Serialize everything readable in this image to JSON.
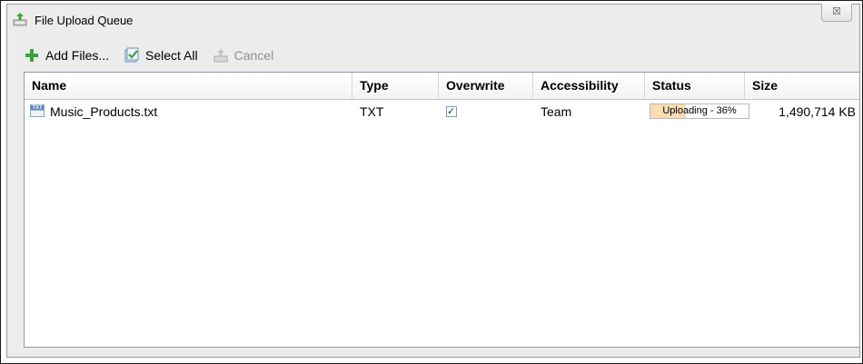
{
  "window": {
    "title": "File Upload Queue",
    "close_glyph": "☒"
  },
  "toolbar": {
    "add_files": "Add Files...",
    "select_all": "Select All",
    "cancel": "Cancel"
  },
  "table": {
    "columns": [
      "Name",
      "Type",
      "Overwrite",
      "Accessibility",
      "Status",
      "Size"
    ],
    "rows": [
      {
        "name": "Music_Products.txt",
        "file_icon_label": "TXT",
        "type": "TXT",
        "overwrite": true,
        "overwrite_glyph": "✓",
        "accessibility": "Team",
        "status": "Uploading - 36%",
        "progress_percent": 36,
        "size": "1,490,714 KB"
      }
    ]
  },
  "colors": {
    "progress_fill": "#f7dcb4",
    "add_icon": "#3aa335",
    "window_bg": "#ececec"
  }
}
